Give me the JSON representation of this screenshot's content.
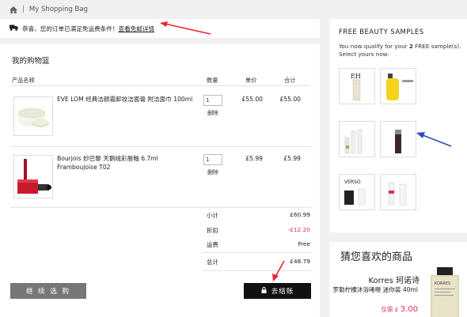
{
  "breadcrumb": {
    "home_icon": "home-icon",
    "separator": "|",
    "current": "My Shopping Bag"
  },
  "banner": {
    "message": "恭喜，您的订单已满足免运费条件！",
    "link": "查看免邮详情",
    "icon": "truck-icon"
  },
  "cart": {
    "title": "我的购物篮",
    "headers": {
      "name": "产品名称",
      "qty": "数量",
      "unit": "单价",
      "total": "合计"
    },
    "items": [
      {
        "name": "EVE LOM 经典洁颜霜卸妆洁面膏 附洁面巾 100ml",
        "qty": "1",
        "remove": "删除",
        "unit": "£55.00",
        "total": "£55.00"
      },
      {
        "name": "Bourjois 妙巴黎 天鹅绒彩唇釉 6.7ml Framboujoise T02",
        "qty": "1",
        "remove": "删除",
        "unit": "£5.99",
        "total": "£5.99"
      }
    ],
    "summary": {
      "subtotal_label": "小计",
      "subtotal": "£60.99",
      "discount_label": "折扣",
      "discount": "-£12.20",
      "shipping_label": "运费",
      "shipping": "Free",
      "total_label": "总计",
      "total": "£48.79"
    },
    "continue_label": "继 续 选 购",
    "checkout_label": "去结账",
    "colors": {
      "discount": "#e0305a",
      "checkout_bg": "#111111",
      "continue_bg": "#777777"
    }
  },
  "samples": {
    "title": "FREE BEAUTY SAMPLES",
    "desc_prefix": "You now qualify for your ",
    "desc_count": "2",
    "desc_suffix": " FREE sample(s). Select yours now:",
    "brand_eh": "EH",
    "brand_verso": "VERSO"
  },
  "recommend": {
    "title": "猜您喜欢的商品",
    "brand": "Korres 珂诺诗",
    "name": "罗勒柠檬沐浴啫喱 迷你装 40ml",
    "price_prefix": "仅需 £ ",
    "price": "3.00",
    "bottle_label": "KORRES"
  }
}
